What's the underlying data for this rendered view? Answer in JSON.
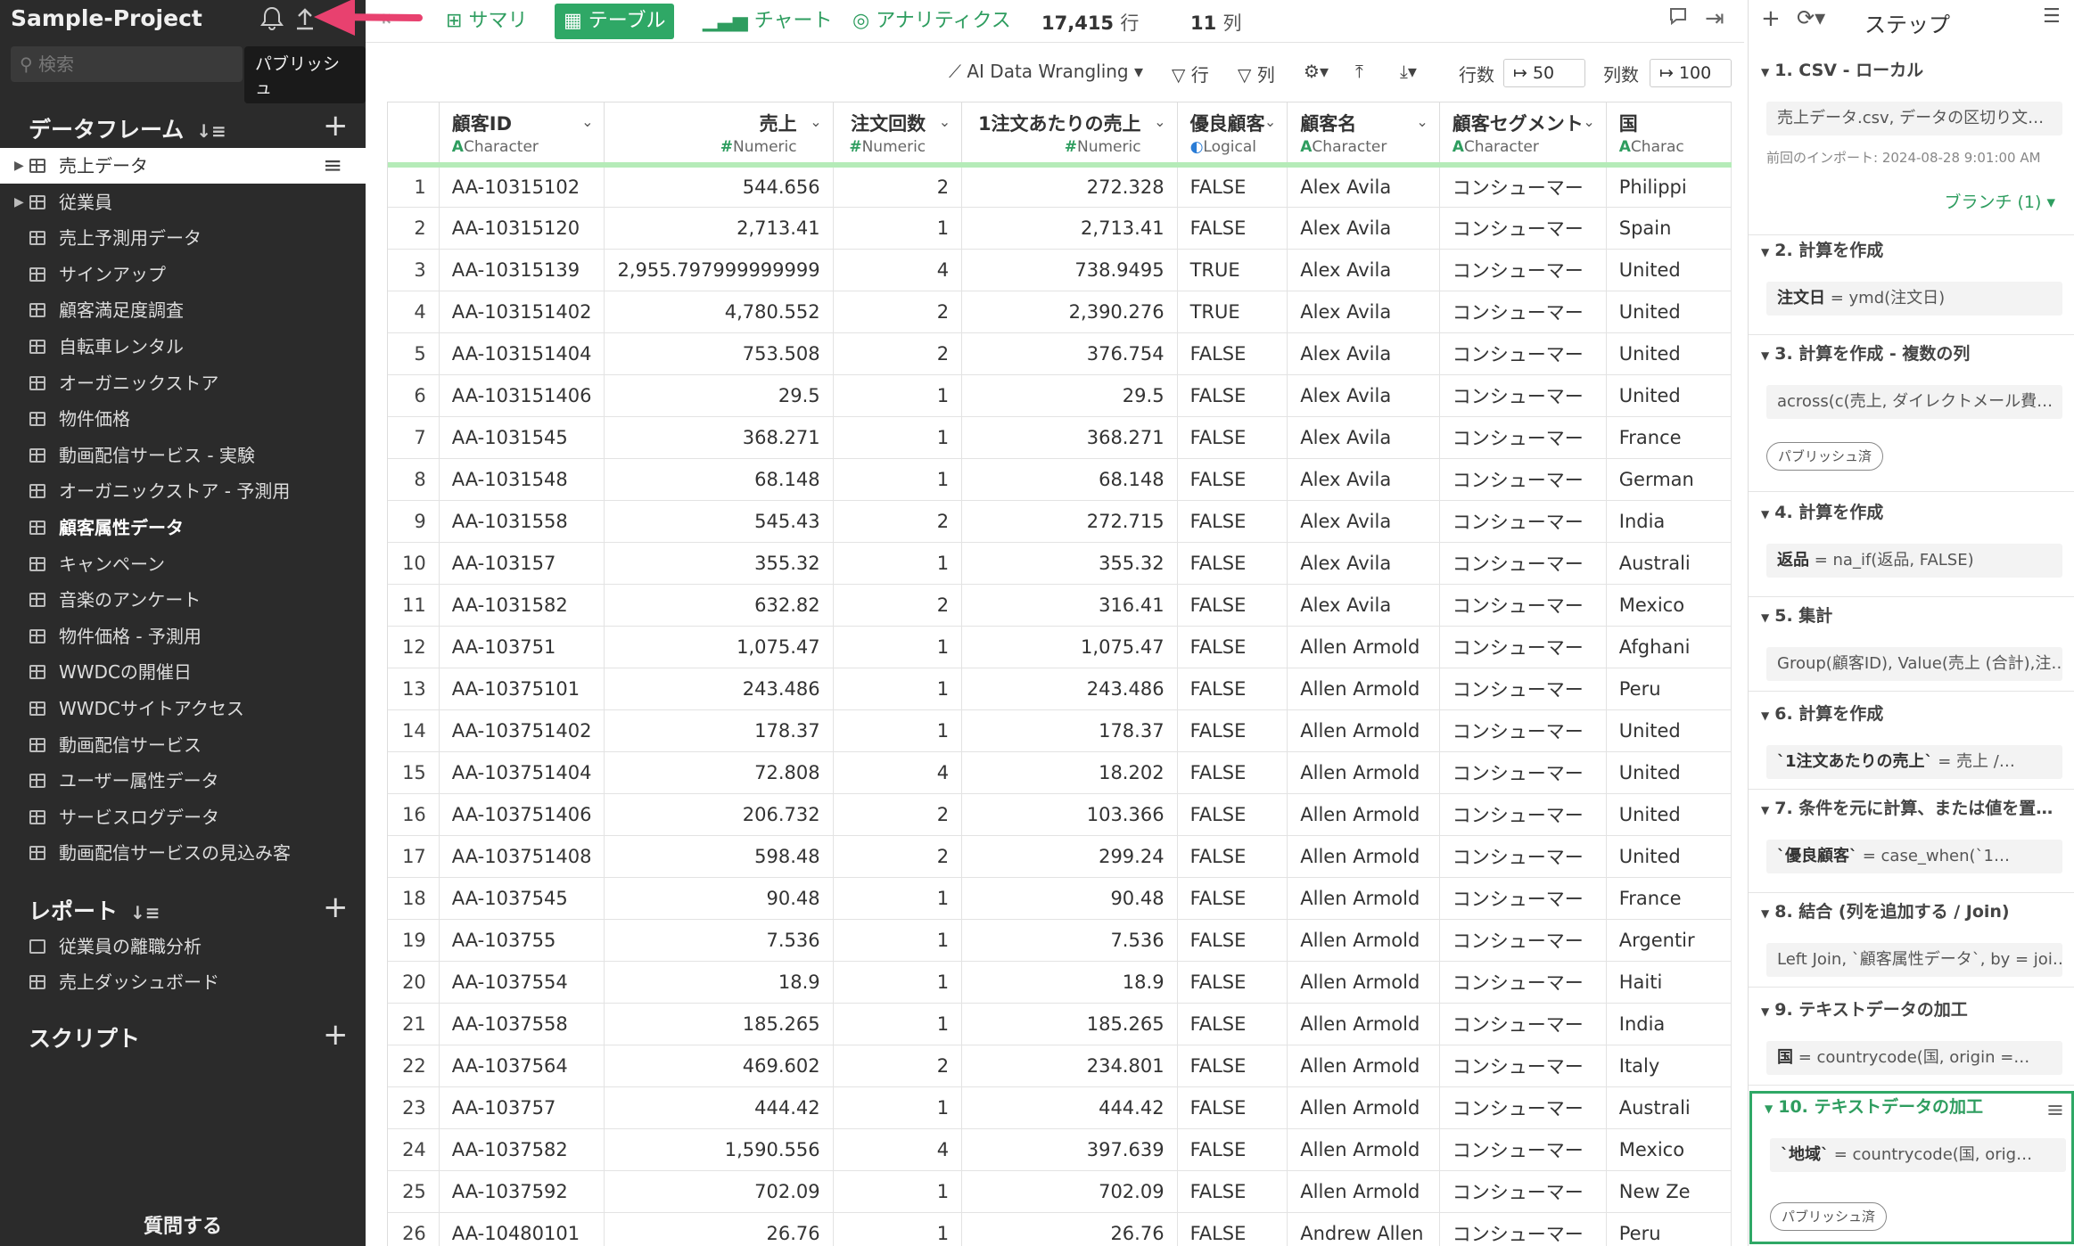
{
  "sidebar": {
    "project_title": "Sample-Project",
    "tooltip": "パブリッシュ",
    "search_placeholder": "検索",
    "dataframes_label": "データフレーム",
    "reports_label": "レポート",
    "scripts_label": "スクリプト",
    "dataframes": [
      {
        "label": "売上データ",
        "active": true
      },
      {
        "label": "従業員"
      },
      {
        "label": "売上予測用データ"
      },
      {
        "label": "サインアップ"
      },
      {
        "label": "顧客満足度調査"
      },
      {
        "label": "自転車レンタル"
      },
      {
        "label": "オーガニックストア"
      },
      {
        "label": "物件価格"
      },
      {
        "label": "動画配信サービス - 実験"
      },
      {
        "label": "オーガニックストア - 予測用"
      },
      {
        "label": "顧客属性データ",
        "bold": true
      },
      {
        "label": "キャンペーン"
      },
      {
        "label": "音楽のアンケート"
      },
      {
        "label": "物件価格 - 予測用"
      },
      {
        "label": "WWDCの開催日"
      },
      {
        "label": "WWDCサイトアクセス"
      },
      {
        "label": "動画配信サービス"
      },
      {
        "label": "ユーザー属性データ"
      },
      {
        "label": "サービスログデータ"
      },
      {
        "label": "動画配信サービスの見込み客"
      }
    ],
    "reports": [
      {
        "label": "従業員の離職分析"
      },
      {
        "label": "売上ダッシュボード"
      }
    ],
    "ask_label": "質問する"
  },
  "topbar": {
    "tabs": [
      {
        "label": "サマリ"
      },
      {
        "label": "テーブル",
        "active": true
      },
      {
        "label": "チャート"
      },
      {
        "label": "アナリティクス"
      }
    ],
    "row_count": "17,415",
    "row_unit": "行",
    "col_count": "11",
    "col_unit": "列"
  },
  "tabletools": {
    "ai": "AI Data Wrangling",
    "row_filter": "行",
    "col_filter": "列",
    "rows_label": "行数",
    "rows_value": "50",
    "cols_label": "列数",
    "cols_value": "100"
  },
  "table": {
    "columns": [
      {
        "name": "顧客ID",
        "type": "Character",
        "mark": "A"
      },
      {
        "name": "売上",
        "type": "Numeric",
        "mark": "#"
      },
      {
        "name": "注文回数",
        "type": "Numeric",
        "mark": "#"
      },
      {
        "name": "1注文あたりの売上",
        "type": "Numeric",
        "mark": "#"
      },
      {
        "name": "優良顧客",
        "type": "Logical",
        "mark": "◐"
      },
      {
        "name": "顧客名",
        "type": "Character",
        "mark": "A"
      },
      {
        "name": "顧客セグメント",
        "type": "Character",
        "mark": "A"
      },
      {
        "name": "国",
        "type": "Charac",
        "mark": "A"
      }
    ],
    "rows": [
      [
        "1",
        "AA-10315102",
        "544.656",
        "2",
        "272.328",
        "FALSE",
        "Alex Avila",
        "コンシューマー",
        "Philippi"
      ],
      [
        "2",
        "AA-10315120",
        "2,713.41",
        "1",
        "2,713.41",
        "FALSE",
        "Alex Avila",
        "コンシューマー",
        "Spain"
      ],
      [
        "3",
        "AA-10315139",
        "2,955.797999999999",
        "4",
        "738.9495",
        "TRUE",
        "Alex Avila",
        "コンシューマー",
        "United"
      ],
      [
        "4",
        "AA-103151402",
        "4,780.552",
        "2",
        "2,390.276",
        "TRUE",
        "Alex Avila",
        "コンシューマー",
        "United"
      ],
      [
        "5",
        "AA-103151404",
        "753.508",
        "2",
        "376.754",
        "FALSE",
        "Alex Avila",
        "コンシューマー",
        "United"
      ],
      [
        "6",
        "AA-103151406",
        "29.5",
        "1",
        "29.5",
        "FALSE",
        "Alex Avila",
        "コンシューマー",
        "United"
      ],
      [
        "7",
        "AA-1031545",
        "368.271",
        "1",
        "368.271",
        "FALSE",
        "Alex Avila",
        "コンシューマー",
        "France"
      ],
      [
        "8",
        "AA-1031548",
        "68.148",
        "1",
        "68.148",
        "FALSE",
        "Alex Avila",
        "コンシューマー",
        "German"
      ],
      [
        "9",
        "AA-1031558",
        "545.43",
        "2",
        "272.715",
        "FALSE",
        "Alex Avila",
        "コンシューマー",
        "India"
      ],
      [
        "10",
        "AA-103157",
        "355.32",
        "1",
        "355.32",
        "FALSE",
        "Alex Avila",
        "コンシューマー",
        "Australi"
      ],
      [
        "11",
        "AA-1031582",
        "632.82",
        "2",
        "316.41",
        "FALSE",
        "Alex Avila",
        "コンシューマー",
        "Mexico"
      ],
      [
        "12",
        "AA-103751",
        "1,075.47",
        "1",
        "1,075.47",
        "FALSE",
        "Allen Armold",
        "コンシューマー",
        "Afghani"
      ],
      [
        "13",
        "AA-10375101",
        "243.486",
        "1",
        "243.486",
        "FALSE",
        "Allen Armold",
        "コンシューマー",
        "Peru"
      ],
      [
        "14",
        "AA-103751402",
        "178.37",
        "1",
        "178.37",
        "FALSE",
        "Allen Armold",
        "コンシューマー",
        "United"
      ],
      [
        "15",
        "AA-103751404",
        "72.808",
        "4",
        "18.202",
        "FALSE",
        "Allen Armold",
        "コンシューマー",
        "United"
      ],
      [
        "16",
        "AA-103751406",
        "206.732",
        "2",
        "103.366",
        "FALSE",
        "Allen Armold",
        "コンシューマー",
        "United"
      ],
      [
        "17",
        "AA-103751408",
        "598.48",
        "2",
        "299.24",
        "FALSE",
        "Allen Armold",
        "コンシューマー",
        "United"
      ],
      [
        "18",
        "AA-1037545",
        "90.48",
        "1",
        "90.48",
        "FALSE",
        "Allen Armold",
        "コンシューマー",
        "France"
      ],
      [
        "19",
        "AA-103755",
        "7.536",
        "1",
        "7.536",
        "FALSE",
        "Allen Armold",
        "コンシューマー",
        "Argentir"
      ],
      [
        "20",
        "AA-1037554",
        "18.9",
        "1",
        "18.9",
        "FALSE",
        "Allen Armold",
        "コンシューマー",
        "Haiti"
      ],
      [
        "21",
        "AA-1037558",
        "185.265",
        "1",
        "185.265",
        "FALSE",
        "Allen Armold",
        "コンシューマー",
        "India"
      ],
      [
        "22",
        "AA-1037564",
        "469.602",
        "2",
        "234.801",
        "FALSE",
        "Allen Armold",
        "コンシューマー",
        "Italy"
      ],
      [
        "23",
        "AA-103757",
        "444.42",
        "1",
        "444.42",
        "FALSE",
        "Allen Armold",
        "コンシューマー",
        "Australi"
      ],
      [
        "24",
        "AA-1037582",
        "1,590.556",
        "4",
        "397.639",
        "FALSE",
        "Allen Armold",
        "コンシューマー",
        "Mexico"
      ],
      [
        "25",
        "AA-1037592",
        "702.09",
        "1",
        "702.09",
        "FALSE",
        "Allen Armold",
        "コンシューマー",
        "New Ze"
      ],
      [
        "26",
        "AA-10480101",
        "26.76",
        "1",
        "26.76",
        "FALSE",
        "Andrew Allen",
        "コンシューマー",
        "Peru"
      ]
    ]
  },
  "rpanel": {
    "title": "ステップ",
    "steps": [
      {
        "title": "1. CSV - ローカル",
        "code": "売上データ.csv, データの区切り文…",
        "note": "前回のインポート: 2024-08-28 9:01:00 AM",
        "branch": "ブランチ (1)"
      },
      {
        "title": "2. 計算を作成",
        "code_b": "注文日",
        "code": " = ymd(注文日)"
      },
      {
        "title": "3. 計算を作成 - 複数の列",
        "code": "across(c(売上, ダイレクトメール費…",
        "pill": "パブリッシュ済"
      },
      {
        "title": "4. 計算を作成",
        "code_b": "返品",
        "code": " = na_if(返品, FALSE)"
      },
      {
        "title": "5. 集計",
        "code": "Group(顧客ID), Value(売上 (合計),注…"
      },
      {
        "title": "6. 計算を作成",
        "code_b": "`1注文あたりの売上`",
        "code": " = 売上 /…"
      },
      {
        "title": "7. 条件を元に計算、または値を置…",
        "code_b": "`優良顧客`",
        "code": " = case_when(`1…"
      },
      {
        "title": "8. 結合 (列を追加する / Join)",
        "code": "Left Join, `顧客属性データ`, by = joi…"
      },
      {
        "title": "9. テキストデータの加工",
        "code_b": "国",
        "code": " = countrycode(国, origin =…"
      },
      {
        "title": "10. テキストデータの加工",
        "code_b": "`地域`",
        "code": " = countrycode(国, orig…",
        "pill": "パブリッシュ済",
        "active": true
      }
    ]
  },
  "colors": {
    "accent": "#2fa866",
    "arrow": "#e8416f",
    "sidebar_bg": "#2b2b2b"
  }
}
